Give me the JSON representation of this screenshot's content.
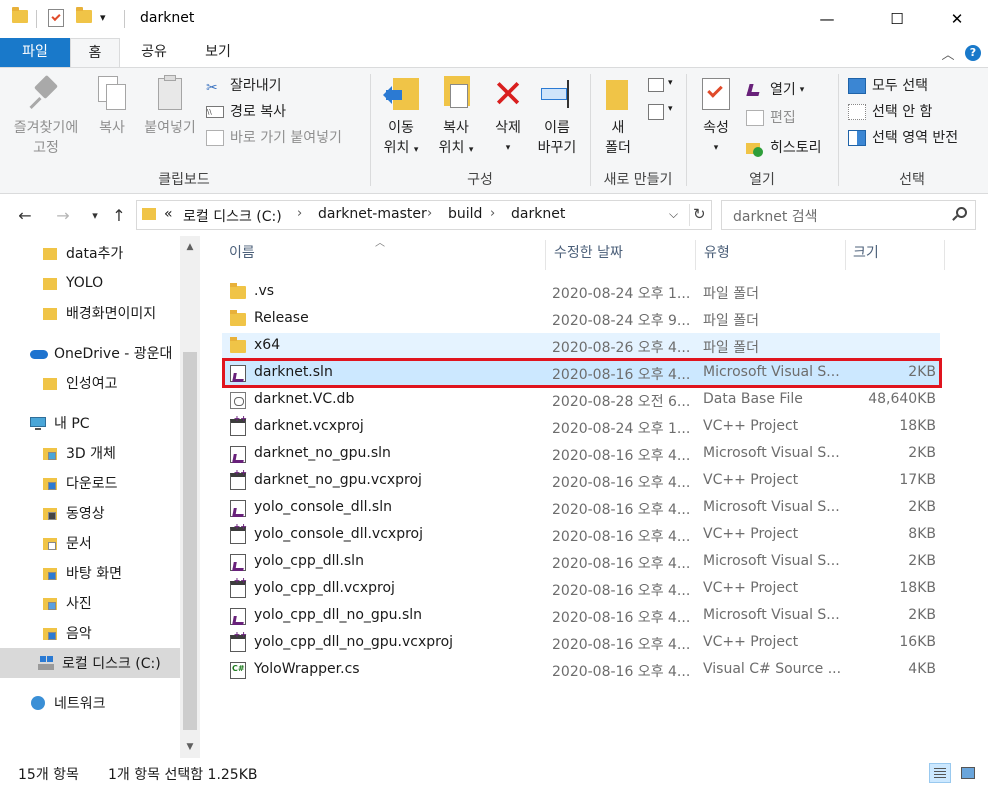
{
  "window": {
    "title": "darknet",
    "minimize": "—",
    "maximize": "☐",
    "close": "✕"
  },
  "ribbon_tabs": [
    {
      "label": "파일"
    },
    {
      "label": "홈"
    },
    {
      "label": "공유"
    },
    {
      "label": "보기"
    }
  ],
  "ribbon": {
    "clipboard": {
      "pin_label_1": "즐겨찾기에",
      "pin_label_2": "고정",
      "copy": "복사",
      "paste": "붙여넣기",
      "cut": "잘라내기",
      "copy_path": "경로 복사",
      "paste_shortcut": "바로 가기 붙여넣기",
      "group": "클립보드"
    },
    "organize": {
      "move_1": "이동",
      "move_2": "위치",
      "copyto_1": "복사",
      "copyto_2": "위치",
      "delete": "삭제",
      "rename_1": "이름",
      "rename_2": "바꾸기",
      "group": "구성"
    },
    "new": {
      "newfolder_1": "새",
      "newfolder_2": "폴더",
      "group": "새로 만들기"
    },
    "open": {
      "properties": "속성",
      "open": "열기",
      "edit": "편집",
      "history": "히스토리",
      "group": "열기"
    },
    "select": {
      "select_all": "모두 선택",
      "select_none": "선택 안 함",
      "invert": "선택 영역 반전",
      "group": "선택"
    }
  },
  "address": {
    "overflow": "«",
    "parts": [
      "로컬 디스크 (C:)",
      "darknet-master",
      "build",
      "darknet"
    ],
    "search_placeholder": "darknet 검색"
  },
  "nav_pane": {
    "items": [
      {
        "label": "data추가",
        "icon": "folder-icon"
      },
      {
        "label": "YOLO",
        "icon": "folder-icon"
      },
      {
        "label": "배경화면이미지",
        "icon": "folder-icon"
      },
      {
        "label": "OneDrive - 광운대",
        "icon": "onedrive-icon"
      },
      {
        "label": "인성여고",
        "icon": "folder-icon"
      },
      {
        "label": "내 PC",
        "icon": "pc-icon"
      },
      {
        "label": "3D 개체",
        "icon": "3d-objects-icon"
      },
      {
        "label": "다운로드",
        "icon": "downloads-icon"
      },
      {
        "label": "동영상",
        "icon": "videos-icon"
      },
      {
        "label": "문서",
        "icon": "documents-icon"
      },
      {
        "label": "바탕 화면",
        "icon": "desktop-icon"
      },
      {
        "label": "사진",
        "icon": "pictures-icon"
      },
      {
        "label": "음악",
        "icon": "music-icon"
      },
      {
        "label": "로컬 디스크 (C:)",
        "icon": "drive-icon"
      },
      {
        "label": "네트워크",
        "icon": "network-icon"
      }
    ]
  },
  "columns": {
    "name": "이름",
    "date": "수정한 날짜",
    "type": "유형",
    "size": "크기"
  },
  "files": [
    {
      "name": ".vs",
      "date": "2020-08-24 오후 1...",
      "type": "파일 폴더",
      "size": "",
      "icon": "folder"
    },
    {
      "name": "Release",
      "date": "2020-08-24 오후 9...",
      "type": "파일 폴더",
      "size": "",
      "icon": "folder"
    },
    {
      "name": "x64",
      "date": "2020-08-26 오후 4...",
      "type": "파일 폴더",
      "size": "",
      "icon": "folder"
    },
    {
      "name": "darknet.sln",
      "date": "2020-08-16 오후 4...",
      "type": "Microsoft Visual S...",
      "size": "2KB",
      "icon": "sln"
    },
    {
      "name": "darknet.VC.db",
      "date": "2020-08-28 오전 6...",
      "type": "Data Base File",
      "size": "48,640KB",
      "icon": "db"
    },
    {
      "name": "darknet.vcxproj",
      "date": "2020-08-24 오후 1...",
      "type": "VC++ Project",
      "size": "18KB",
      "icon": "proj"
    },
    {
      "name": "darknet_no_gpu.sln",
      "date": "2020-08-16 오후 4...",
      "type": "Microsoft Visual S...",
      "size": "2KB",
      "icon": "sln"
    },
    {
      "name": "darknet_no_gpu.vcxproj",
      "date": "2020-08-16 오후 4...",
      "type": "VC++ Project",
      "size": "17KB",
      "icon": "proj"
    },
    {
      "name": "yolo_console_dll.sln",
      "date": "2020-08-16 오후 4...",
      "type": "Microsoft Visual S...",
      "size": "2KB",
      "icon": "sln"
    },
    {
      "name": "yolo_console_dll.vcxproj",
      "date": "2020-08-16 오후 4...",
      "type": "VC++ Project",
      "size": "8KB",
      "icon": "proj"
    },
    {
      "name": "yolo_cpp_dll.sln",
      "date": "2020-08-16 오후 4...",
      "type": "Microsoft Visual S...",
      "size": "2KB",
      "icon": "sln"
    },
    {
      "name": "yolo_cpp_dll.vcxproj",
      "date": "2020-08-16 오후 4...",
      "type": "VC++ Project",
      "size": "18KB",
      "icon": "proj"
    },
    {
      "name": "yolo_cpp_dll_no_gpu.sln",
      "date": "2020-08-16 오후 4...",
      "type": "Microsoft Visual S...",
      "size": "2KB",
      "icon": "sln"
    },
    {
      "name": "yolo_cpp_dll_no_gpu.vcxproj",
      "date": "2020-08-16 오후 4...",
      "type": "VC++ Project",
      "size": "16KB",
      "icon": "proj"
    },
    {
      "name": "YoloWrapper.cs",
      "date": "2020-08-16 오후 4...",
      "type": "Visual C# Source ...",
      "size": "4KB",
      "icon": "cs"
    }
  ],
  "status": {
    "count": "15개 항목",
    "selection": "1개 항목 선택함 1.25KB"
  },
  "colors": {
    "file_tab": "#1979ca",
    "selected_row": "#cce8ff",
    "hover_row": "#e5f3ff",
    "highlight_box": "#e0141e"
  }
}
